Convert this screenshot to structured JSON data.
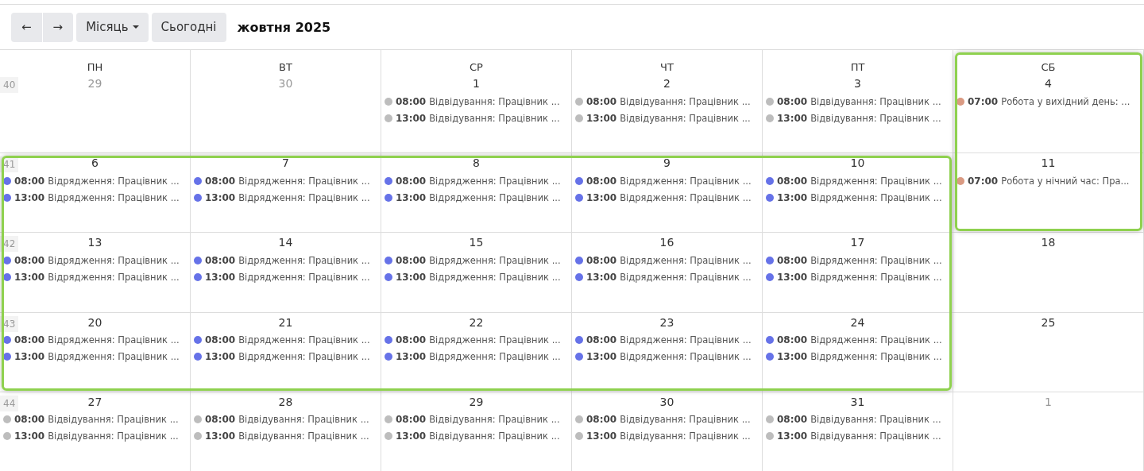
{
  "toolbar": {
    "prev": "←",
    "next": "→",
    "view": "Місяць",
    "today": "Сьогодні",
    "title": "жовтня 2025"
  },
  "weekdays": [
    "ПН",
    "ВТ",
    "СР",
    "ЧТ",
    "ПТ",
    "СБ"
  ],
  "weeks": [
    {
      "number": "40",
      "days": [
        {
          "day": "29",
          "other_month": true
        },
        {
          "day": "30",
          "other_month": true
        },
        {
          "day": "1",
          "other_month": false,
          "events": [
            {
              "time": "08:00",
              "title": "Відвідування: Працівник ...",
              "color": "#bdbdbd"
            },
            {
              "time": "13:00",
              "title": "Відвідування: Працівник ...",
              "color": "#bdbdbd"
            }
          ]
        },
        {
          "day": "2",
          "other_month": false,
          "events": [
            {
              "time": "08:00",
              "title": "Відвідування: Працівник ...",
              "color": "#bdbdbd"
            },
            {
              "time": "13:00",
              "title": "Відвідування: Працівник ...",
              "color": "#bdbdbd"
            }
          ]
        },
        {
          "day": "3",
          "other_month": false,
          "events": [
            {
              "time": "08:00",
              "title": "Відвідування: Працівник ...",
              "color": "#bdbdbd"
            },
            {
              "time": "13:00",
              "title": "Відвідування: Працівник ...",
              "color": "#bdbdbd"
            }
          ]
        },
        {
          "day": "4",
          "other_month": false,
          "events": [
            {
              "time": "07:00",
              "title": "Робота у вихідний день: ...",
              "color": "#da9a82"
            }
          ]
        }
      ]
    },
    {
      "number": "41",
      "days": [
        {
          "day": "6",
          "other_month": false,
          "events": [
            {
              "time": "08:00",
              "title": "Відрядження: Працівник ...",
              "color": "#6672e8"
            },
            {
              "time": "13:00",
              "title": "Відрядження: Працівник ...",
              "color": "#6672e8"
            }
          ]
        },
        {
          "day": "7",
          "other_month": false,
          "events": [
            {
              "time": "08:00",
              "title": "Відрядження: Працівник ...",
              "color": "#6672e8"
            },
            {
              "time": "13:00",
              "title": "Відрядження: Працівник ...",
              "color": "#6672e8"
            }
          ]
        },
        {
          "day": "8",
          "other_month": false,
          "events": [
            {
              "time": "08:00",
              "title": "Відрядження: Працівник ...",
              "color": "#6672e8"
            },
            {
              "time": "13:00",
              "title": "Відрядження: Працівник ...",
              "color": "#6672e8"
            }
          ]
        },
        {
          "day": "9",
          "other_month": false,
          "events": [
            {
              "time": "08:00",
              "title": "Відрядження: Працівник ...",
              "color": "#6672e8"
            },
            {
              "time": "13:00",
              "title": "Відрядження: Працівник ...",
              "color": "#6672e8"
            }
          ]
        },
        {
          "day": "10",
          "other_month": false,
          "events": [
            {
              "time": "08:00",
              "title": "Відрядження: Працівник ...",
              "color": "#6672e8"
            },
            {
              "time": "13:00",
              "title": "Відрядження: Працівник ...",
              "color": "#6672e8"
            }
          ]
        },
        {
          "day": "11",
          "other_month": false,
          "events": [
            {
              "time": "07:00",
              "title": "Робота у нічний час: Пра...",
              "color": "#da9a82"
            }
          ]
        }
      ]
    },
    {
      "number": "42",
      "days": [
        {
          "day": "13",
          "other_month": false,
          "events": [
            {
              "time": "08:00",
              "title": "Відрядження: Працівник ...",
              "color": "#6672e8"
            },
            {
              "time": "13:00",
              "title": "Відрядження: Працівник ...",
              "color": "#6672e8"
            }
          ]
        },
        {
          "day": "14",
          "other_month": false,
          "events": [
            {
              "time": "08:00",
              "title": "Відрядження: Працівник ...",
              "color": "#6672e8"
            },
            {
              "time": "13:00",
              "title": "Відрядження: Працівник ...",
              "color": "#6672e8"
            }
          ]
        },
        {
          "day": "15",
          "other_month": false,
          "events": [
            {
              "time": "08:00",
              "title": "Відрядження: Працівник ...",
              "color": "#6672e8"
            },
            {
              "time": "13:00",
              "title": "Відрядження: Працівник ...",
              "color": "#6672e8"
            }
          ]
        },
        {
          "day": "16",
          "other_month": false,
          "events": [
            {
              "time": "08:00",
              "title": "Відрядження: Працівник ...",
              "color": "#6672e8"
            },
            {
              "time": "13:00",
              "title": "Відрядження: Працівник ...",
              "color": "#6672e8"
            }
          ]
        },
        {
          "day": "17",
          "other_month": false,
          "events": [
            {
              "time": "08:00",
              "title": "Відрядження: Працівник ...",
              "color": "#6672e8"
            },
            {
              "time": "13:00",
              "title": "Відрядження: Працівник ...",
              "color": "#6672e8"
            }
          ]
        },
        {
          "day": "18",
          "other_month": false
        }
      ]
    },
    {
      "number": "43",
      "days": [
        {
          "day": "20",
          "other_month": false,
          "events": [
            {
              "time": "08:00",
              "title": "Відрядження: Працівник ...",
              "color": "#6672e8"
            },
            {
              "time": "13:00",
              "title": "Відрядження: Працівник ...",
              "color": "#6672e8"
            }
          ]
        },
        {
          "day": "21",
          "other_month": false,
          "events": [
            {
              "time": "08:00",
              "title": "Відрядження: Працівник ...",
              "color": "#6672e8"
            },
            {
              "time": "13:00",
              "title": "Відрядження: Працівник ...",
              "color": "#6672e8"
            }
          ]
        },
        {
          "day": "22",
          "other_month": false,
          "events": [
            {
              "time": "08:00",
              "title": "Відрядження: Працівник ...",
              "color": "#6672e8"
            },
            {
              "time": "13:00",
              "title": "Відрядження: Працівник ...",
              "color": "#6672e8"
            }
          ]
        },
        {
          "day": "23",
          "other_month": false,
          "events": [
            {
              "time": "08:00",
              "title": "Відрядження: Працівник ...",
              "color": "#6672e8"
            },
            {
              "time": "13:00",
              "title": "Відрядження: Працівник ...",
              "color": "#6672e8"
            }
          ]
        },
        {
          "day": "24",
          "other_month": false,
          "events": [
            {
              "time": "08:00",
              "title": "Відрядження: Працівник ...",
              "color": "#6672e8"
            },
            {
              "time": "13:00",
              "title": "Відрядження: Працівник ...",
              "color": "#6672e8"
            }
          ]
        },
        {
          "day": "25",
          "other_month": false
        }
      ]
    },
    {
      "number": "44",
      "days": [
        {
          "day": "27",
          "other_month": false,
          "events": [
            {
              "time": "08:00",
              "title": "Відвідування: Працівник ...",
              "color": "#bdbdbd"
            },
            {
              "time": "13:00",
              "title": "Відвідування: Працівник ...",
              "color": "#bdbdbd"
            }
          ]
        },
        {
          "day": "28",
          "other_month": false,
          "events": [
            {
              "time": "08:00",
              "title": "Відвідування: Працівник ...",
              "color": "#bdbdbd"
            },
            {
              "time": "13:00",
              "title": "Відвідування: Працівник ...",
              "color": "#bdbdbd"
            }
          ]
        },
        {
          "day": "29",
          "other_month": false,
          "events": [
            {
              "time": "08:00",
              "title": "Відвідування: Працівник ...",
              "color": "#bdbdbd"
            },
            {
              "time": "13:00",
              "title": "Відвідування: Працівник ...",
              "color": "#bdbdbd"
            }
          ]
        },
        {
          "day": "30",
          "other_month": false,
          "events": [
            {
              "time": "08:00",
              "title": "Відвідування: Працівник ...",
              "color": "#bdbdbd"
            },
            {
              "time": "13:00",
              "title": "Відвідування: Працівник ...",
              "color": "#bdbdbd"
            }
          ]
        },
        {
          "day": "31",
          "other_month": false,
          "events": [
            {
              "time": "08:00",
              "title": "Відвідування: Працівник ...",
              "color": "#bdbdbd"
            },
            {
              "time": "13:00",
              "title": "Відвідування: Працівник ...",
              "color": "#bdbdbd"
            }
          ]
        },
        {
          "day": "1",
          "other_month": true
        }
      ]
    }
  ]
}
